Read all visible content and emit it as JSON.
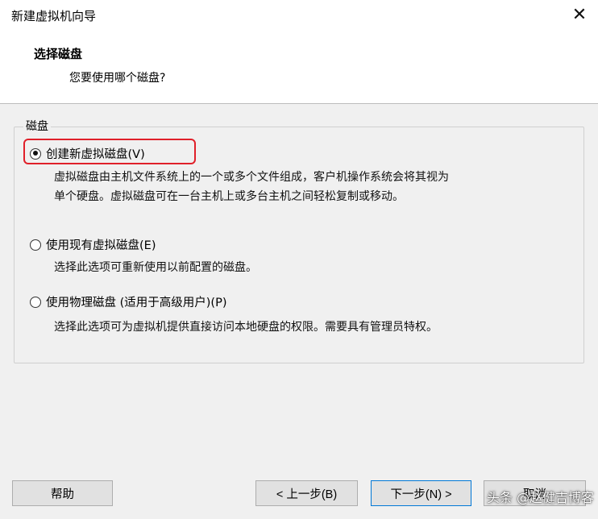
{
  "window": {
    "title": "新建虚拟机向导",
    "close_symbol": "✕"
  },
  "header": {
    "title": "选择磁盘",
    "subtitle": "您要使用哪个磁盘?"
  },
  "group": {
    "legend": "磁盘",
    "options": [
      {
        "label": "创建新虚拟磁盘(V)",
        "selected": true,
        "description_lines": [
          "虚拟磁盘由主机文件系统上的一个或多个文件组成，客户机操作系统会将其视为",
          "单个硬盘。虚拟磁盘可在一台主机上或多台主机之间轻松复制或移动。"
        ]
      },
      {
        "label": "使用现有虚拟磁盘(E)",
        "selected": false,
        "description_lines": [
          "选择此选项可重新使用以前配置的磁盘。"
        ]
      },
      {
        "label": "使用物理磁盘 (适用于高级用户)(P)",
        "selected": false,
        "description_lines": [
          "选择此选项可为虚拟机提供直接访问本地硬盘的权限。需要具有管理员特权。"
        ]
      }
    ]
  },
  "buttons": {
    "help": "帮助",
    "back": "< 上一步(B)",
    "next": "下一步(N) >",
    "cancel": "取消"
  },
  "watermark": "头条 @赵健吉博客",
  "colors": {
    "highlight": "#e0202a",
    "default_button_border": "#0078d7"
  }
}
